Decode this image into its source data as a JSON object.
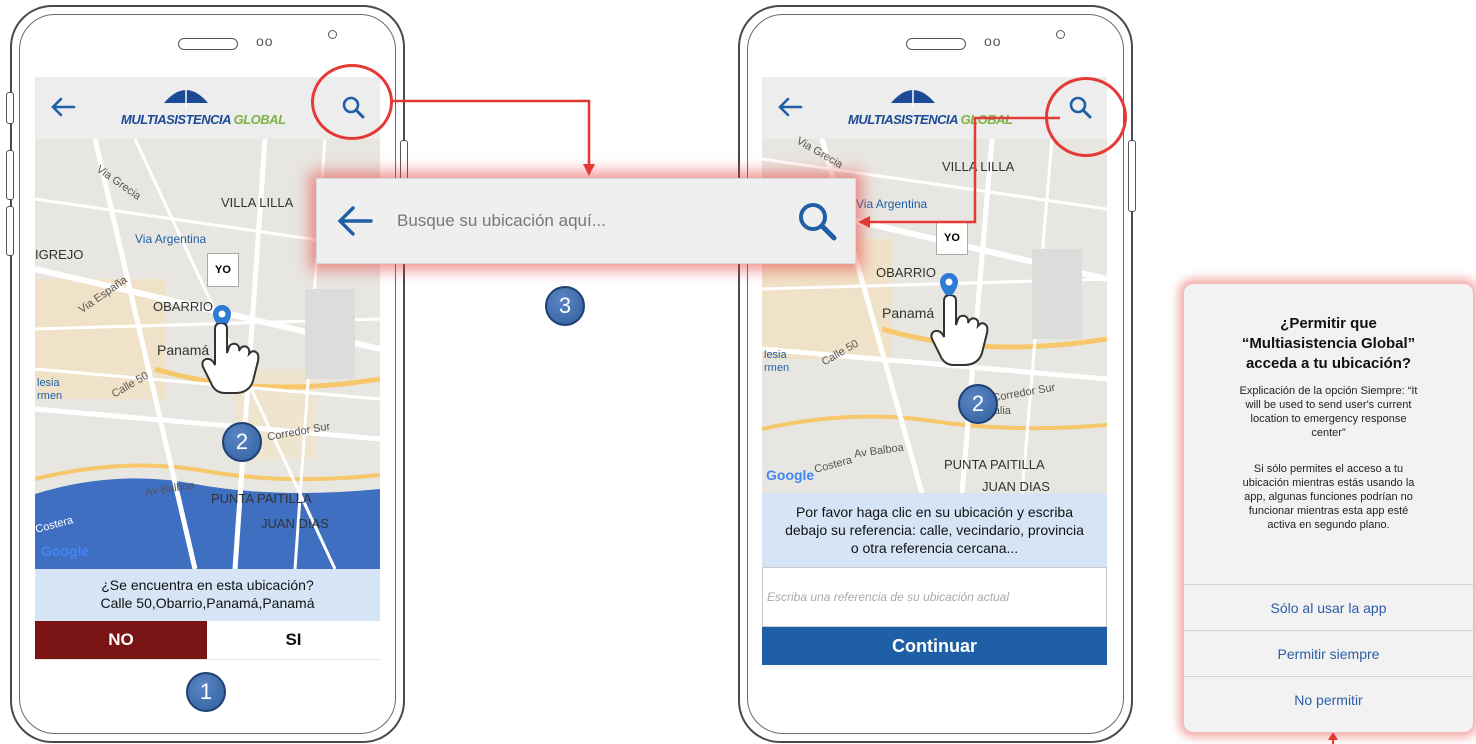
{
  "app": {
    "logo_part1": "MULTIASISTENCIA",
    "logo_part2": "GLOBAL"
  },
  "map_labels": {
    "via_grecia": "Via Grecia",
    "villa_lilla": "VILLA LILLA",
    "via_argentina": "Via Argentina",
    "grejo": "IGREJO",
    "via_espana": "Via España",
    "obarrio": "OBARRIO",
    "panama": "Panamá",
    "calle50": "Calle 50",
    "corredor_sur": "Corredor Sur",
    "av_balboa": "Av Balboa",
    "punta_paitilla": "PUNTA PAITILLA",
    "juan_dias": "JUAN DIAS",
    "costera": "Costera",
    "iglesia": "lesia",
    "carmen": "rmen",
    "av_italia": "Av Italia",
    "google": "Google",
    "yo": "YO"
  },
  "screen1": {
    "question_line1": "¿Se encuentra en esta ubicación?",
    "question_line2": "Calle 50,Obarrio,Panamá,Panamá",
    "no_label": "NO",
    "si_label": "SI"
  },
  "screen2": {
    "instruction_line1": "Por favor haga clic en su ubicación y escriba",
    "instruction_line2": "debajo su referencia: calle, vecindario, provincia",
    "instruction_line3": "o otra referencia cercana...",
    "reference_placeholder": "Escriba una referencia de su ubicación actual",
    "continue_label": "Continuar"
  },
  "search_overlay": {
    "placeholder": "Busque su ubicación aquí..."
  },
  "badges": {
    "step1": "1",
    "step2": "2",
    "step3": "3"
  },
  "permission_dialog": {
    "title_line1": "¿Permitir que",
    "title_line2": "“Multiasistencia Global”",
    "title_line3": "acceda a tu ubicación?",
    "explain_line1": "Explicación de la opción Siempre: “It",
    "explain_line2": "will be used to send user's current",
    "explain_line3": "location to emergency response",
    "explain_line4": "center”",
    "note_line1": "Si sólo permites el acceso a tu",
    "note_line2": "ubicación mientras estás usando la",
    "note_line3": "app, algunas funciones podrían no",
    "note_line4": "funcionar mientras esta app esté",
    "note_line5": "activa en segundo plano.",
    "option_while_using": "Sólo al usar la app",
    "option_always": "Permitir siempre",
    "option_deny": "No permitir"
  },
  "colors": {
    "accent_blue": "#1f5fa6",
    "no_button": "#7a1414",
    "callout_red": "#e53935",
    "question_bg": "#d5e5f6"
  }
}
